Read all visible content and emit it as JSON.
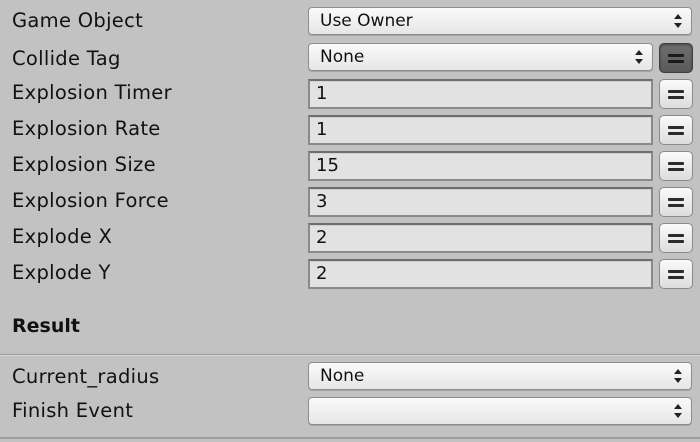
{
  "rows": {
    "game_object": {
      "label": "Game Object",
      "value": "Use Owner"
    },
    "collide_tag": {
      "label": "Collide Tag",
      "value": "None"
    },
    "explosion_timer": {
      "label": "Explosion Timer",
      "value": "1"
    },
    "explosion_rate": {
      "label": "Explosion Rate",
      "value": "1"
    },
    "explosion_size": {
      "label": "Explosion Size",
      "value": "15"
    },
    "explosion_force": {
      "label": "Explosion Force",
      "value": "3"
    },
    "explode_x": {
      "label": "Explode X",
      "value": "2"
    },
    "explode_y": {
      "label": "Explode Y",
      "value": "2"
    }
  },
  "result": {
    "title": "Result",
    "current_radius": {
      "label": "Current_radius",
      "value": "None"
    },
    "finish_event": {
      "label": "Finish Event",
      "value": ""
    }
  },
  "icons": {
    "dropdown": "updown-arrows-icon",
    "variable_toggle": "equals-icon"
  }
}
